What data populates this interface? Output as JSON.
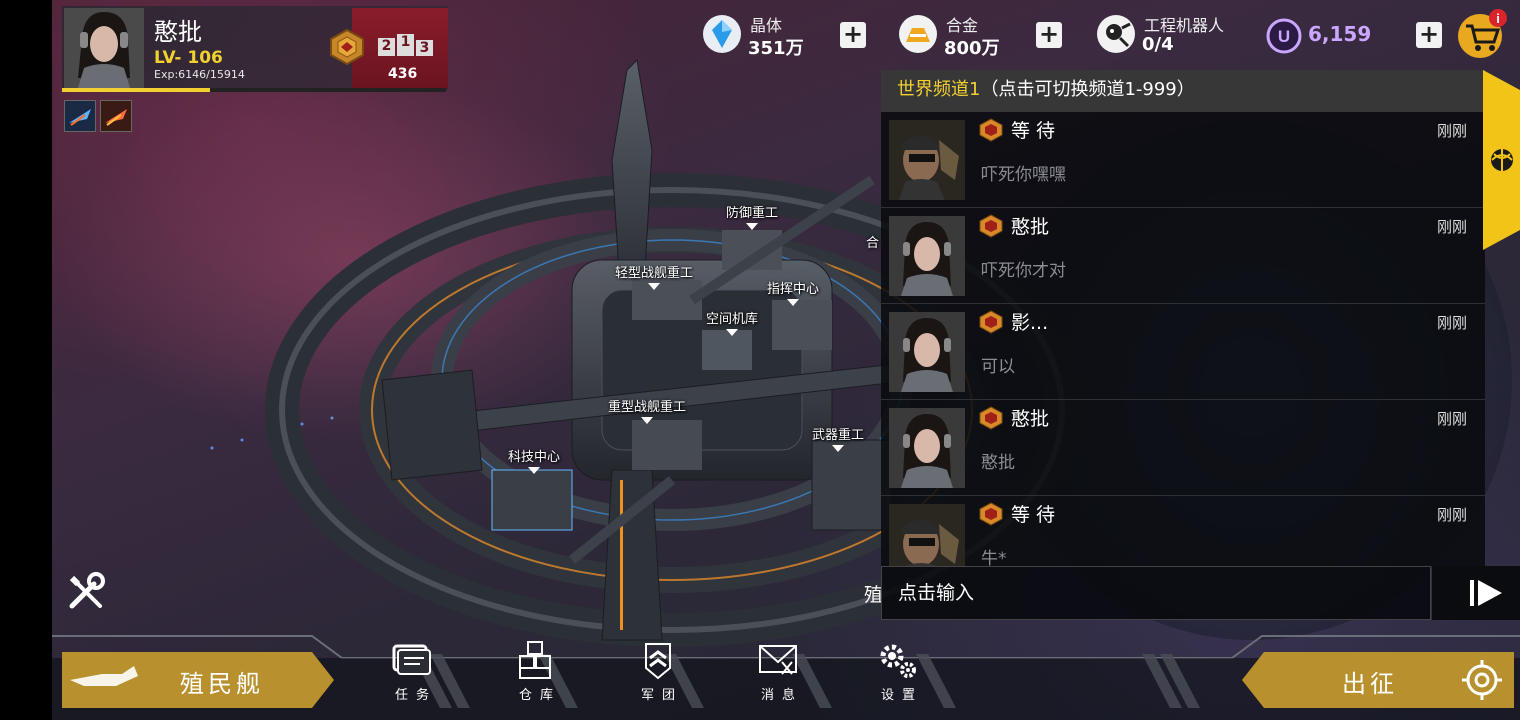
{
  "profile": {
    "name": "憨批",
    "level": "LV- 106",
    "exp": "Exp:6146/15914",
    "exp_fraction": 0.386,
    "rank_digits": [
      "2",
      "1",
      "3"
    ],
    "rank_score": "436"
  },
  "resources": {
    "crystal": {
      "label": "晶体",
      "value": "351万"
    },
    "alloy": {
      "label": "合金",
      "value": "800万"
    },
    "robot": {
      "label": "工程机器人",
      "value": "0/4"
    },
    "u_currency": {
      "value": "6,159"
    }
  },
  "buildings": {
    "defense": "防御重工",
    "light_ship": "轻型战舰重工",
    "command": "指挥中心",
    "hangar": "空间机库",
    "heavy_ship": "重型战舰重工",
    "tech": "科技中心",
    "weapon": "武器重工",
    "partial": "合"
  },
  "chat": {
    "channel": "世界频道1",
    "channel_hint": "（点击可切换频道1-999）",
    "messages": [
      {
        "nick": "等 待",
        "time": "刚刚",
        "text": "吓死你嘿嘿",
        "avatar": "eyepatch-man"
      },
      {
        "nick": "憨批",
        "time": "刚刚",
        "text": "吓死你才对",
        "avatar": "headset-woman"
      },
      {
        "nick": "影...",
        "time": "刚刚",
        "text": "可以",
        "avatar": "headset-woman"
      },
      {
        "nick": "憨批",
        "time": "刚刚",
        "text": "憨批",
        "avatar": "headset-woman"
      },
      {
        "nick": "等 待",
        "time": "刚刚",
        "text": "牛*",
        "avatar": "eyepatch-man"
      }
    ],
    "input_placeholder": "点击输入",
    "colony_partial": "殖"
  },
  "bottom": {
    "colony_ship": "殖民舰",
    "expedition": "出征",
    "nav": [
      {
        "id": "tasks",
        "label": "任务",
        "icon": "task-icon"
      },
      {
        "id": "warehouse",
        "label": "仓库",
        "icon": "boxes-icon"
      },
      {
        "id": "legion",
        "label": "军团",
        "icon": "chevron-shield-icon"
      },
      {
        "id": "messages",
        "label": "消息",
        "icon": "mail-icon"
      },
      {
        "id": "settings",
        "label": "设置",
        "icon": "gears-icon"
      }
    ]
  },
  "colors": {
    "accent_yellow": "#f2d030",
    "rank_red": "#7a1826",
    "u_purple": "#c9a6ff",
    "bottom_gold": "#b8902e"
  }
}
